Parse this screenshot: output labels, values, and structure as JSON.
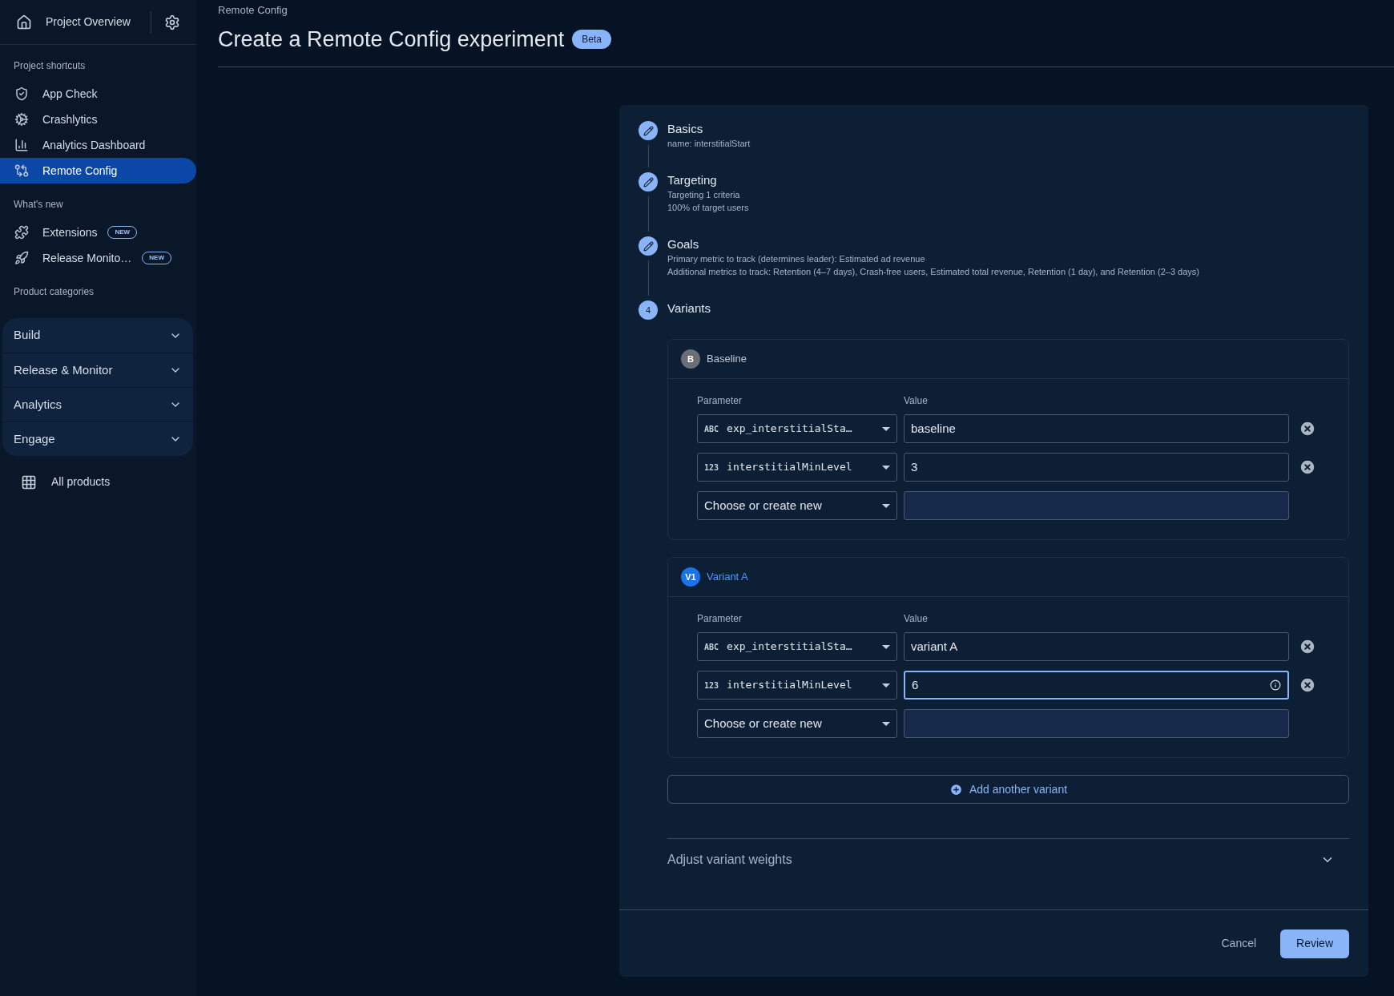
{
  "sidebar": {
    "project": {
      "label": "Project Overview"
    },
    "sections": [
      {
        "heading": "Project shortcuts",
        "items": [
          {
            "label": "App Check",
            "kind": "shield",
            "selected": false
          },
          {
            "label": "Crashlytics",
            "kind": "gears",
            "selected": false
          },
          {
            "label": "Analytics Dashboard",
            "kind": "bars",
            "selected": false
          },
          {
            "label": "Remote Config",
            "kind": "config",
            "selected": true
          }
        ]
      },
      {
        "heading": "What's new",
        "items": [
          {
            "label": "Extensions",
            "kind": "puzzle",
            "selected": false,
            "badge": "NEW"
          },
          {
            "label": "Release Monito…",
            "kind": "rocket",
            "selected": false,
            "badge": "NEW"
          }
        ]
      },
      {
        "heading": "Product categories"
      }
    ],
    "categories": [
      {
        "label": "Build",
        "expanded": false
      },
      {
        "label": "Release & Monitor",
        "expanded": false
      },
      {
        "label": "Analytics",
        "expanded": false
      },
      {
        "label": "Engage",
        "expanded": false
      }
    ],
    "all_products": "All products"
  },
  "header": {
    "breadcrumb": "Remote Config",
    "title": "Create a Remote Config experiment",
    "badge": "Beta"
  },
  "steps": [
    {
      "title": "Basics",
      "completed": true,
      "lines": [
        "name: interstitialStart"
      ]
    },
    {
      "title": "Targeting",
      "completed": true,
      "lines": [
        "Targeting 1 criteria",
        "100% of target users"
      ]
    },
    {
      "title": "Goals",
      "completed": true,
      "lines": [
        "Primary metric to track (determines leader): Estimated ad revenue",
        "Additional metrics to track: Retention (4–7 days), Crash-free users, Estimated total revenue, Retention (1 day), and Retention (2–3 days)"
      ]
    },
    {
      "title": "Variants",
      "completed": false,
      "number": "4"
    }
  ],
  "variants": [
    {
      "kind": "baseline",
      "badge": "B",
      "name": "Baseline",
      "param_label": "Parameter",
      "value_label": "Value",
      "rows": [
        {
          "kind": "param",
          "type": "ABC",
          "name": "exp_interstitialSta…",
          "value": "baseline",
          "focused": false
        },
        {
          "kind": "param",
          "type": "123",
          "name": "interstitialMinLevel",
          "value": "3",
          "focused": false
        },
        {
          "kind": "empty",
          "name": "Choose or create new"
        }
      ]
    },
    {
      "kind": "variant",
      "badge": "V1",
      "name": "Variant A",
      "param_label": "Parameter",
      "value_label": "Value",
      "rows": [
        {
          "kind": "param",
          "type": "ABC",
          "name": "exp_interstitialSta…",
          "value": "variant A",
          "focused": false
        },
        {
          "kind": "param",
          "type": "123",
          "name": "interstitialMinLevel",
          "value": "6",
          "focused": true
        },
        {
          "kind": "empty",
          "name": "Choose or create new"
        }
      ]
    }
  ],
  "add_variant": "Add another variant",
  "weights": {
    "label": "Adjust variant weights",
    "expanded": false
  },
  "footer": {
    "cancel": "Cancel",
    "review": "Review"
  }
}
